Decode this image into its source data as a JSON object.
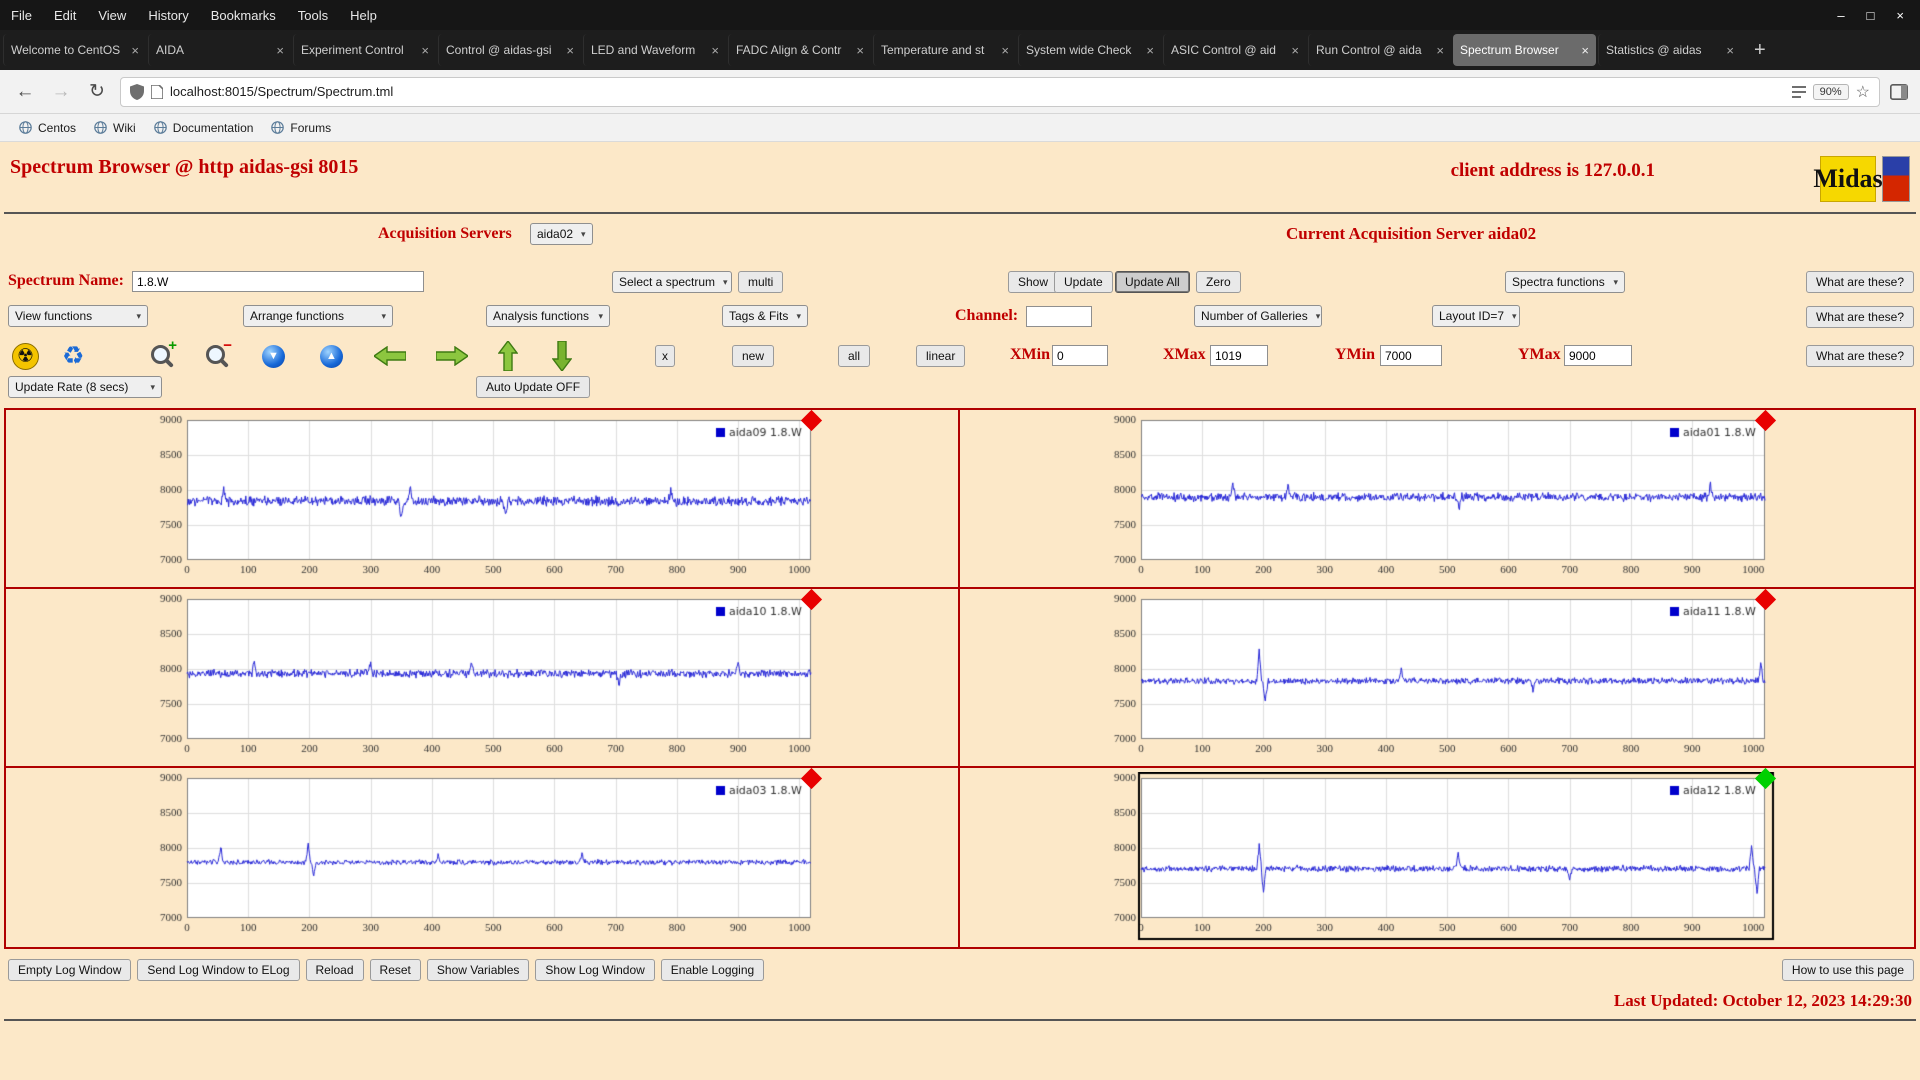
{
  "ui": {
    "caret": "▾",
    "close": "×",
    "minimize": "–",
    "maximize": "□",
    "back": "←",
    "forward": "→",
    "reload": "↻",
    "star": "☆",
    "plus": "+",
    "radiation": "☢",
    "recycle": "♻",
    "tri_up": "▲",
    "tri_down": "▼",
    "mag_plus": "+",
    "mag_minus": "−"
  },
  "browser": {
    "menu_items": [
      "File",
      "Edit",
      "View",
      "History",
      "Bookmarks",
      "Tools",
      "Help"
    ],
    "tabs": [
      {
        "label": "Welcome to CentOS",
        "active": false
      },
      {
        "label": "AIDA",
        "active": false
      },
      {
        "label": "Experiment Control",
        "active": false
      },
      {
        "label": "Control @ aidas-gsi",
        "active": false
      },
      {
        "label": "LED and Waveform",
        "active": false
      },
      {
        "label": "FADC Align & Contr",
        "active": false
      },
      {
        "label": "Temperature and st",
        "active": false
      },
      {
        "label": "System wide Check",
        "active": false
      },
      {
        "label": "ASIC Control @ aid",
        "active": false
      },
      {
        "label": "Run Control @ aida",
        "active": false
      },
      {
        "label": "Spectrum Browser",
        "active": true
      },
      {
        "label": "Statistics @ aidas",
        "active": false
      }
    ],
    "url": "localhost:8015/Spectrum/Spectrum.tml",
    "zoom_level": "90%",
    "bookmarks": [
      "Centos",
      "Wiki",
      "Documentation",
      "Forums"
    ]
  },
  "page": {
    "title": "Spectrum Browser @ http aidas-gsi 8015",
    "client_address": "client address is 127.0.0.1",
    "logo_midas": "Midas",
    "acquisition_servers_label": "Acquisition Servers",
    "acquisition_server_selected": "aida02",
    "current_server": "Current Acquisition Server aida02",
    "spectrum_name_label": "Spectrum Name:",
    "spectrum_name_value": "1.8.W",
    "select_spectrum": "Select a spectrum",
    "multi": "multi",
    "show": "Show",
    "update": "Update",
    "update_all": "Update All",
    "zero": "Zero",
    "spectra_functions": "Spectra functions",
    "what_are_these": "What are these?",
    "view_functions": "View functions",
    "arrange_functions": "Arrange functions",
    "analysis_functions": "Analysis functions",
    "tags_fits": "Tags & Fits",
    "channel_label": "Channel:",
    "channel_value": "",
    "number_of_galleries": "Number of Galleries",
    "layout_id": "Layout ID=7",
    "btn_x": "x",
    "btn_new": "new",
    "btn_all": "all",
    "btn_linear": "linear",
    "xmin_label": "XMin",
    "xmin_value": "0",
    "xmax_label": "XMax",
    "xmax_value": "1019",
    "ymin_label": "YMin",
    "ymin_value": "7000",
    "ymax_label": "YMax",
    "ymax_value": "9000",
    "update_rate": "Update Rate (8 secs)",
    "auto_update": "Auto Update OFF",
    "footer_buttons": [
      "Empty Log Window",
      "Send Log Window to ELog",
      "Reload",
      "Reset",
      "Show Variables",
      "Show Log Window",
      "Enable Logging"
    ],
    "how_to": "How to use this page",
    "last_updated": "Last Updated: October 12, 2023 14:29:30"
  },
  "chart_data": [
    {
      "type": "line",
      "legend": "aida09 1.8.W",
      "seed": 9,
      "baseline": 7840,
      "noise": 85,
      "spikes": [
        {
          "x": 60,
          "amp": 170
        },
        {
          "x": 350,
          "amp": -230
        },
        {
          "x": 365,
          "amp": 200
        },
        {
          "x": 520,
          "amp": -180
        },
        {
          "x": 790,
          "amp": 160
        }
      ],
      "xlim": [
        0,
        1019
      ],
      "ylim": [
        7000,
        9000
      ],
      "xticks": [
        0,
        100,
        200,
        300,
        400,
        500,
        600,
        700,
        800,
        900,
        1000
      ],
      "yticks": [
        7000,
        7500,
        8000,
        8500,
        9000
      ],
      "line_color": "#2828d8",
      "marker_color": "#e80000",
      "highlighted": false
    },
    {
      "type": "line",
      "legend": "aida01 1.8.W",
      "seed": 1,
      "baseline": 7900,
      "noise": 75,
      "spikes": [
        {
          "x": 150,
          "amp": 170
        },
        {
          "x": 240,
          "amp": 190
        },
        {
          "x": 520,
          "amp": -170
        },
        {
          "x": 930,
          "amp": 160
        }
      ],
      "xlim": [
        0,
        1019
      ],
      "ylim": [
        7000,
        9000
      ],
      "xticks": [
        0,
        100,
        200,
        300,
        400,
        500,
        600,
        700,
        800,
        900,
        1000
      ],
      "yticks": [
        7000,
        7500,
        8000,
        8500,
        9000
      ],
      "line_color": "#2828d8",
      "marker_color": "#e80000",
      "highlighted": false
    },
    {
      "type": "line",
      "legend": "aida10 1.8.W",
      "seed": 10,
      "baseline": 7935,
      "noise": 70,
      "spikes": [
        {
          "x": 110,
          "amp": 160
        },
        {
          "x": 300,
          "amp": 180
        },
        {
          "x": 465,
          "amp": 170
        },
        {
          "x": 705,
          "amp": -150
        },
        {
          "x": 900,
          "amp": 150
        }
      ],
      "xlim": [
        0,
        1019
      ],
      "ylim": [
        7000,
        9000
      ],
      "xticks": [
        0,
        100,
        200,
        300,
        400,
        500,
        600,
        700,
        800,
        900,
        1000
      ],
      "yticks": [
        7000,
        7500,
        8000,
        8500,
        9000
      ],
      "line_color": "#2828d8",
      "marker_color": "#e80000",
      "highlighted": false
    },
    {
      "type": "line",
      "legend": "aida11 1.8.W",
      "seed": 11,
      "baseline": 7830,
      "noise": 55,
      "spikes": [
        {
          "x": 193,
          "amp": 430
        },
        {
          "x": 203,
          "amp": -300
        },
        {
          "x": 425,
          "amp": 150
        },
        {
          "x": 640,
          "amp": -140
        },
        {
          "x": 1012,
          "amp": 240
        }
      ],
      "xlim": [
        0,
        1019
      ],
      "ylim": [
        7000,
        9000
      ],
      "xticks": [
        0,
        100,
        200,
        300,
        400,
        500,
        600,
        700,
        800,
        900,
        1000
      ],
      "yticks": [
        7000,
        7500,
        8000,
        8500,
        9000
      ],
      "line_color": "#2828d8",
      "marker_color": "#e80000",
      "highlighted": false
    },
    {
      "type": "line",
      "legend": "aida03 1.8.W",
      "seed": 3,
      "baseline": 7795,
      "noise": 45,
      "spikes": [
        {
          "x": 55,
          "amp": 230
        },
        {
          "x": 198,
          "amp": 250
        },
        {
          "x": 207,
          "amp": -190
        },
        {
          "x": 410,
          "amp": 110
        },
        {
          "x": 645,
          "amp": 120
        }
      ],
      "xlim": [
        0,
        1019
      ],
      "ylim": [
        7000,
        9000
      ],
      "xticks": [
        0,
        100,
        200,
        300,
        400,
        500,
        600,
        700,
        800,
        900,
        1000
      ],
      "yticks": [
        7000,
        7500,
        8000,
        8500,
        9000
      ],
      "line_color": "#2828d8",
      "marker_color": "#e80000",
      "highlighted": false
    },
    {
      "type": "line",
      "legend": "aida12 1.8.W",
      "seed": 12,
      "baseline": 7705,
      "noise": 55,
      "spikes": [
        {
          "x": 193,
          "amp": 340
        },
        {
          "x": 200,
          "amp": -330
        },
        {
          "x": 518,
          "amp": 250
        },
        {
          "x": 700,
          "amp": -170
        },
        {
          "x": 997,
          "amp": 310
        },
        {
          "x": 1006,
          "amp": -360
        }
      ],
      "xlim": [
        0,
        1019
      ],
      "ylim": [
        7000,
        9000
      ],
      "xticks": [
        0,
        100,
        200,
        300,
        400,
        500,
        600,
        700,
        800,
        900,
        1000
      ],
      "yticks": [
        7000,
        7500,
        8000,
        8500,
        9000
      ],
      "line_color": "#2828d8",
      "marker_color": "#00d000",
      "highlighted": true
    }
  ]
}
